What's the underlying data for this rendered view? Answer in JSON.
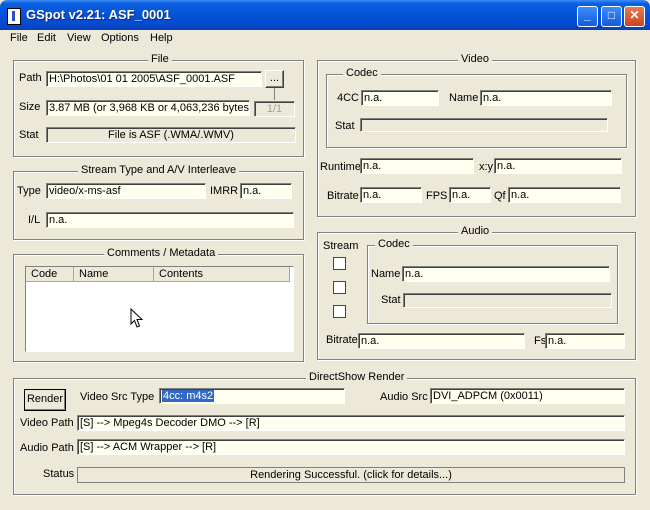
{
  "window": {
    "title": "GSpot v2.21: ASF_0001",
    "minimize": "_",
    "maximize": "□",
    "close": "✕"
  },
  "menu": [
    "File",
    "Edit",
    "View",
    "Options",
    "Help"
  ],
  "file": {
    "legend": "File",
    "path_label": "Path",
    "path": "H:\\Photos\\01 01 2005\\ASF_0001.ASF",
    "browse_label": "...",
    "size_label": "Size",
    "size": "3.87 MB (or 3,968 KB or 4,063,236 bytes)",
    "part": "1/1",
    "stat_label": "Stat",
    "stat": "File is ASF (.WMA/.WMV)"
  },
  "stream": {
    "legend": "Stream Type and A/V Interleave",
    "type_label": "Type",
    "type": "video/x-ms-asf",
    "imrr_label": "IMRR",
    "imrr": "n.a.",
    "il_label": "I/L",
    "il": "n.a."
  },
  "comments": {
    "legend": "Comments / Metadata",
    "columns": [
      "Code",
      "Name",
      "Contents"
    ]
  },
  "video": {
    "legend": "Video",
    "codec_legend": "Codec",
    "fourcc_label": "4CC",
    "fourcc": "n.a.",
    "name_label": "Name",
    "name": "n.a.",
    "stat_label": "Stat",
    "stat": "",
    "runtime_label": "Runtime",
    "runtime": "n.a.",
    "xy_label": "x:y",
    "xy": "n.a.",
    "bitrate_label": "Bitrate",
    "bitrate": "n.a.",
    "fps_label": "FPS",
    "fps": "n.a.",
    "qf_label": "Qf",
    "qf": "n.a."
  },
  "audio": {
    "legend": "Audio",
    "stream_label": "Stream",
    "codec_legend": "Codec",
    "name_label": "Name",
    "name": "n.a.",
    "stat_label": "Stat",
    "stat": "",
    "bitrate_label": "Bitrate",
    "bitrate": "n.a.",
    "fs_label": "Fs",
    "fs": "n.a."
  },
  "directshow": {
    "legend": "DirectShow Render",
    "render_button": "Render",
    "video_src_type_label": "Video Src Type",
    "video_src_type": "4cc: m4s2",
    "audio_src_label": "Audio Src",
    "audio_src": "DVI_ADPCM (0x0011)",
    "video_path_label": "Video Path",
    "video_path": "[S] --> Mpeg4s Decoder DMO --> [R]",
    "audio_path_label": "Audio Path",
    "audio_path": "[S] --> ACM Wrapper --> [R]",
    "status_label": "Status",
    "status": "Rendering Successful.  (click for details...)"
  }
}
